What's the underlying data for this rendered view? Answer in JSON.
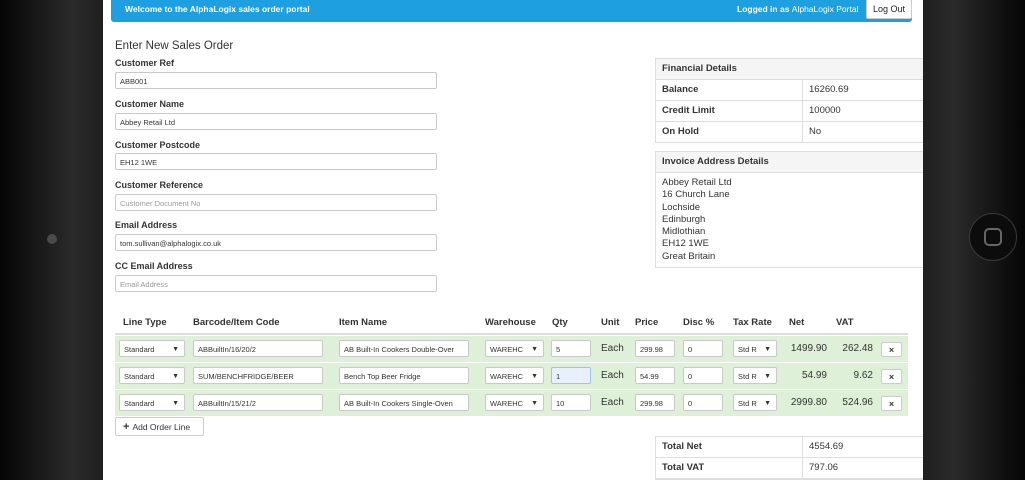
{
  "topbar": {
    "welcome": "Welcome to the AlphaLogix sales order portal",
    "logged_in_prefix": "Logged in as",
    "user": "AlphaLogix Portal",
    "logout": "Log Out"
  },
  "page_title": "Enter New Sales Order",
  "form": {
    "customer_ref": {
      "label": "Customer Ref",
      "value": "ABB001"
    },
    "customer_name": {
      "label": "Customer Name",
      "value": "Abbey Retail Ltd"
    },
    "customer_postcode": {
      "label": "Customer Postcode",
      "value": "EH12 1WE"
    },
    "customer_reference": {
      "label": "Customer Reference",
      "placeholder": "Customer Document No"
    },
    "email": {
      "label": "Email Address",
      "value": "tom.sullivan@alphalogix.co.uk"
    },
    "cc_email": {
      "label": "CC Email Address",
      "placeholder": "Email Address"
    }
  },
  "financial": {
    "title": "Financial Details",
    "rows": [
      {
        "k": "Balance",
        "v": "16260.69"
      },
      {
        "k": "Credit Limit",
        "v": "100000"
      },
      {
        "k": "On Hold",
        "v": "No"
      }
    ]
  },
  "invoice": {
    "title": "Invoice Address Details",
    "lines": [
      "Abbey Retail Ltd",
      "16 Church Lane",
      "Lochside",
      "Edinburgh",
      "Midlothian",
      "EH12 1WE",
      "Great Britain"
    ]
  },
  "lines_table": {
    "headers": [
      "Line Type",
      "Barcode/Item Code",
      "Item Name",
      "Warehouse",
      "Qty",
      "Unit",
      "Price",
      "Disc %",
      "Tax Rate",
      "Net",
      "VAT"
    ],
    "rows": [
      {
        "line_type": "Standard",
        "code": "ABBuiltIn/16/20/2",
        "name": "AB Built-In Cookers Double-Over",
        "warehouse": "WAREHC",
        "qty": "5",
        "unit": "Each",
        "price": "299.98",
        "disc": "0",
        "tax": "Std R",
        "net": "1499.90",
        "vat": "262.48",
        "del": "×"
      },
      {
        "line_type": "Standard",
        "code": "SUM/BENCHFRIDGE/BEER",
        "name": "Bench Top Beer Fridge",
        "warehouse": "WAREHC",
        "qty": "1",
        "unit": "Each",
        "price": "54.99",
        "disc": "0",
        "tax": "Std R",
        "net": "54.99",
        "vat": "9.62",
        "del": "×"
      },
      {
        "line_type": "Standard",
        "code": "ABBuiltIn/15/21/2",
        "name": "AB Built-In Cookers Single-Oven",
        "warehouse": "WAREHC",
        "qty": "10",
        "unit": "Each",
        "price": "299.98",
        "disc": "0",
        "tax": "Std R",
        "net": "2999.80",
        "vat": "524.96",
        "del": "×"
      }
    ]
  },
  "add_line_label": "Add Order Line",
  "totals": [
    {
      "k": "Total Net",
      "v": "4554.69"
    },
    {
      "k": "Total VAT",
      "v": "797.06"
    }
  ],
  "colors": {
    "topbar": "#1e9fe0",
    "row_bg": "#dff0d8"
  }
}
